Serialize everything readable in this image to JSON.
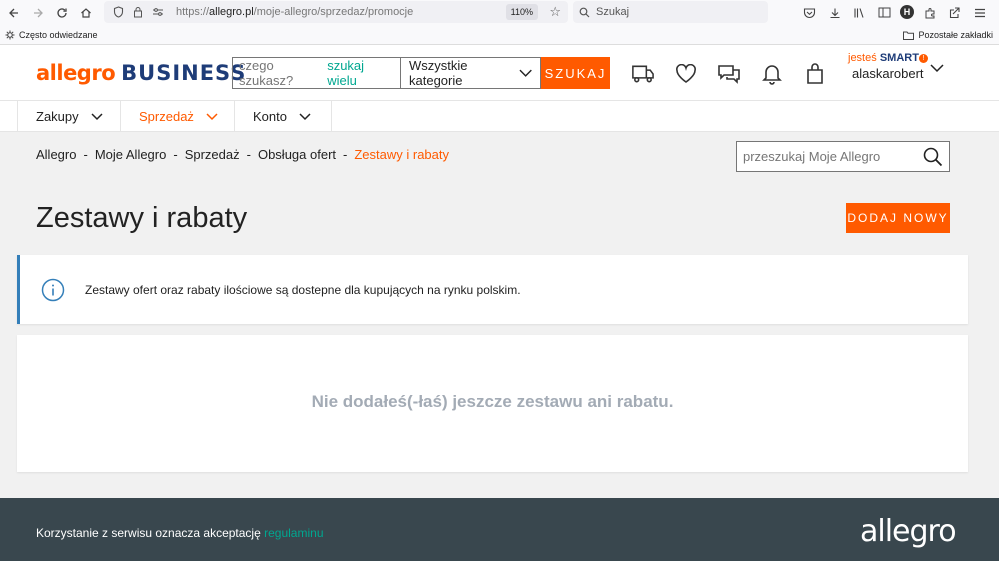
{
  "browser": {
    "url_prefix": "https://",
    "url_domain": "allegro.pl",
    "url_path": "/moje-allegro/sprzedaz/promocje",
    "zoom": "110%",
    "search_placeholder": "Szukaj",
    "profile_initial": "H"
  },
  "bookmarks": {
    "left_label": "Często odwiedzane",
    "right_label": "Pozostałe zakładki"
  },
  "header": {
    "logo_allegro": "allegro",
    "logo_business": "BUSINESS",
    "search_placeholder": "czego szukasz?",
    "search_multi": "szukaj wielu",
    "category": "Wszystkie kategorie",
    "search_button": "SZUKAJ",
    "smart_prefix": "jesteś",
    "smart_label": "SMART",
    "username": "alaskarobert"
  },
  "nav": {
    "items": [
      {
        "label": "Zakupy"
      },
      {
        "label": "Sprzedaż"
      },
      {
        "label": "Konto"
      }
    ]
  },
  "breadcrumb": {
    "items": [
      "Allegro",
      "Moje Allegro",
      "Sprzedaż",
      "Obsługa ofert"
    ],
    "current": "Zestawy i rabaty",
    "separator": "-"
  },
  "moje_search": {
    "placeholder": "przeszukaj Moje Allegro"
  },
  "page": {
    "title": "Zestawy i rabaty",
    "add_button": "DODAJ NOWY",
    "info_text": "Zestawy ofert oraz rabaty ilościowe są dostepne dla kupujących na rynku polskim.",
    "empty_text": "Nie dodałeś(-łaś) jeszcze zestawu ani rabatu."
  },
  "footer": {
    "text": "Korzystanie z serwisu oznacza akceptację",
    "link": "regulaminu",
    "logo": "allegro"
  },
  "colors": {
    "accent": "#ff5a00",
    "business_blue": "#1e3c78",
    "link_teal": "#00a790",
    "info_border": "#347fb9",
    "footer_bg": "#39474e"
  }
}
